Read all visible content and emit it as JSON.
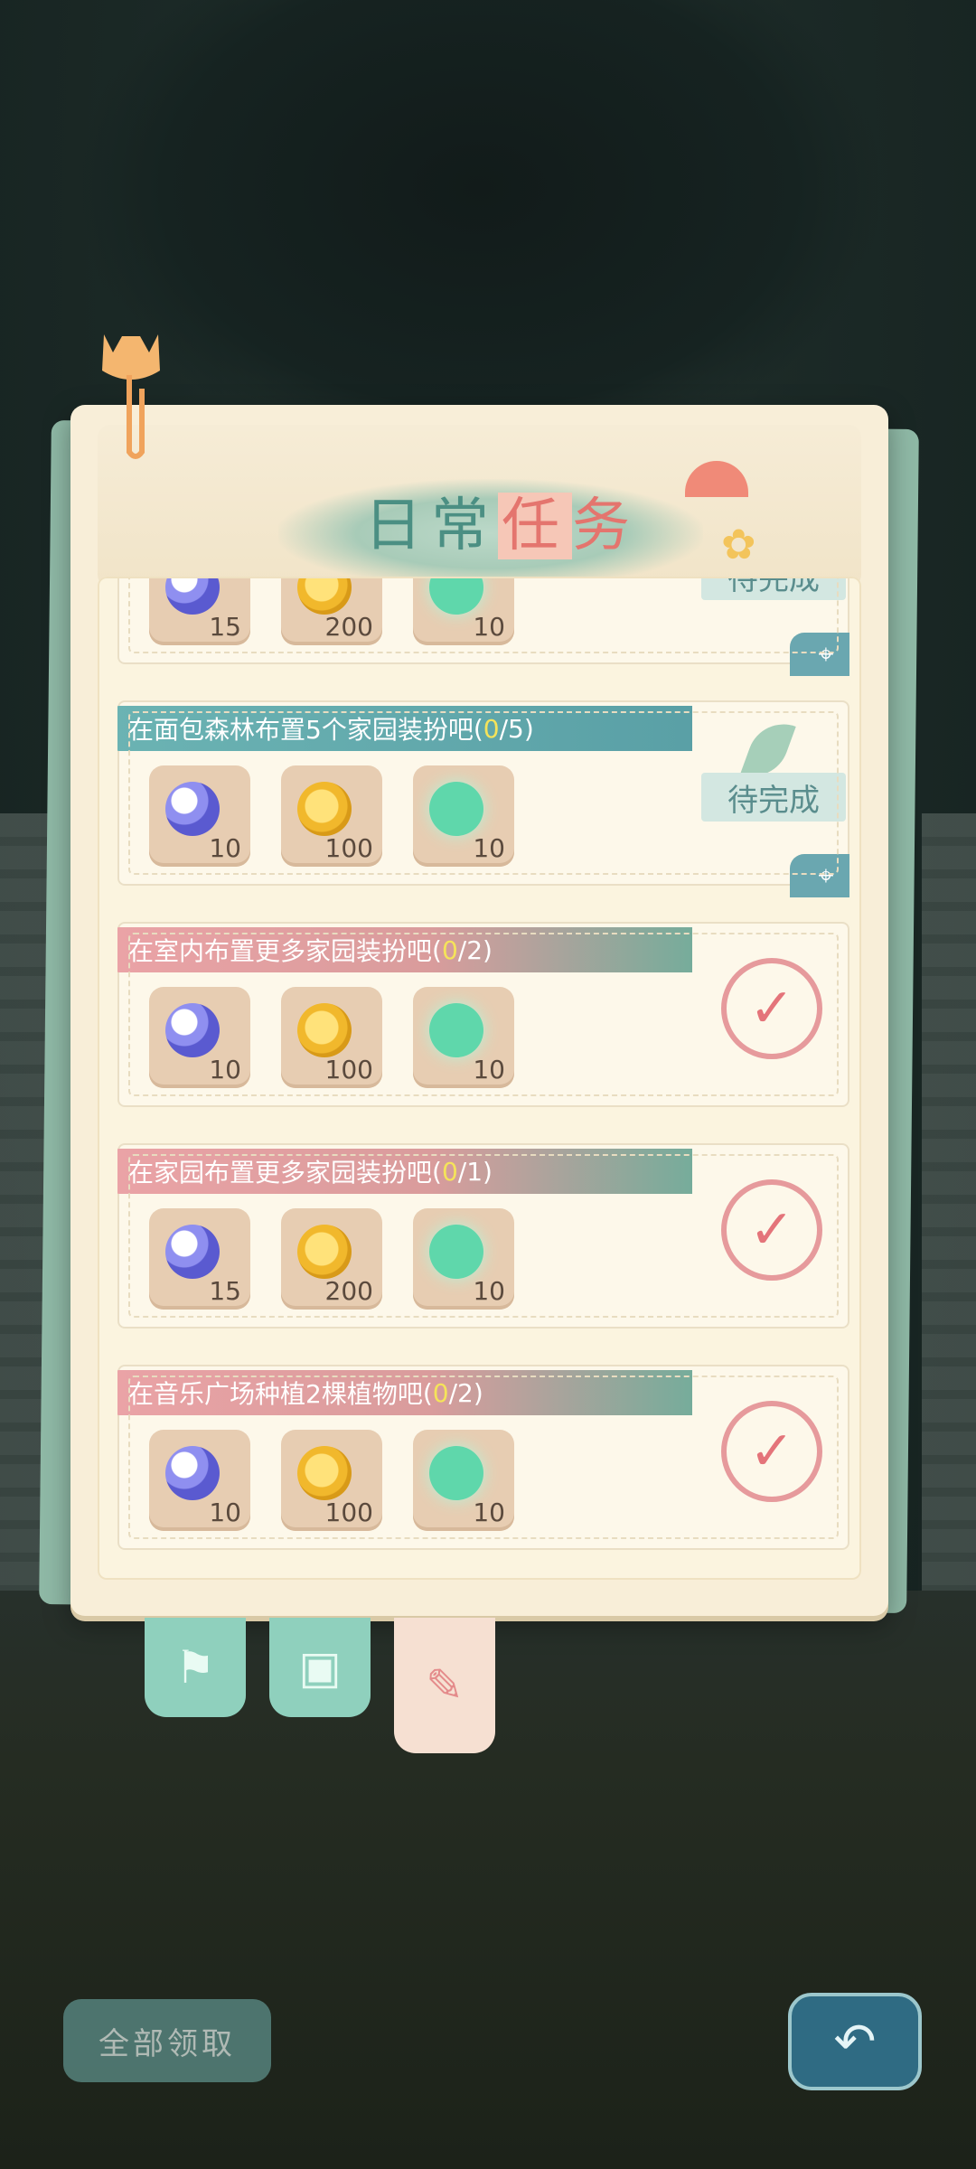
{
  "title": {
    "part1": "日常",
    "part2": "任",
    "part3": "务"
  },
  "tasks": [
    {
      "title": "",
      "progress": "",
      "rewards": [
        {
          "type": "moon-icon",
          "count": "15"
        },
        {
          "type": "coin-icon",
          "count": "200"
        },
        {
          "type": "gem-icon",
          "count": "10"
        }
      ],
      "status": "待完成"
    },
    {
      "title": "在面包森林布置5个家园装扮吧",
      "progress_open": "(",
      "progress_done": "0",
      "progress_rest": "/5)",
      "rewards": [
        {
          "type": "moon-icon",
          "count": "10"
        },
        {
          "type": "coin-icon",
          "count": "100"
        },
        {
          "type": "gem-icon",
          "count": "10"
        }
      ],
      "status": "待完成"
    },
    {
      "title": "在室内布置更多家园装扮吧",
      "progress_open": "(",
      "progress_done": "0",
      "progress_rest": "/2)",
      "rewards": [
        {
          "type": "moon-icon",
          "count": "10"
        },
        {
          "type": "coin-icon",
          "count": "100"
        },
        {
          "type": "gem-icon",
          "count": "10"
        }
      ]
    },
    {
      "title": "在家园布置更多家园装扮吧",
      "progress_open": "(",
      "progress_done": "0",
      "progress_rest": "/1)",
      "rewards": [
        {
          "type": "moon-icon",
          "count": "15"
        },
        {
          "type": "coin-icon",
          "count": "200"
        },
        {
          "type": "gem-icon",
          "count": "10"
        }
      ]
    },
    {
      "title": "在音乐广场种植2棵植物吧",
      "progress_open": "(",
      "progress_done": "0",
      "progress_rest": "/2)",
      "rewards": [
        {
          "type": "moon-icon",
          "count": "10"
        },
        {
          "type": "coin-icon",
          "count": "100"
        },
        {
          "type": "gem-icon",
          "count": "10"
        }
      ]
    }
  ],
  "buttons": {
    "claim_all": "全部领取"
  },
  "icons": {
    "locate": "crosshair-icon",
    "check": "check-icon",
    "back": "return-icon",
    "tab1": "flag-icon",
    "tab2": "paw-card-icon",
    "tab3": "notepad-pencil-icon"
  },
  "colors": {
    "title": "#4b8f83",
    "title_accent": "#e4756e",
    "progress_highlight": "#f5e35a",
    "check": "#e4747a"
  }
}
